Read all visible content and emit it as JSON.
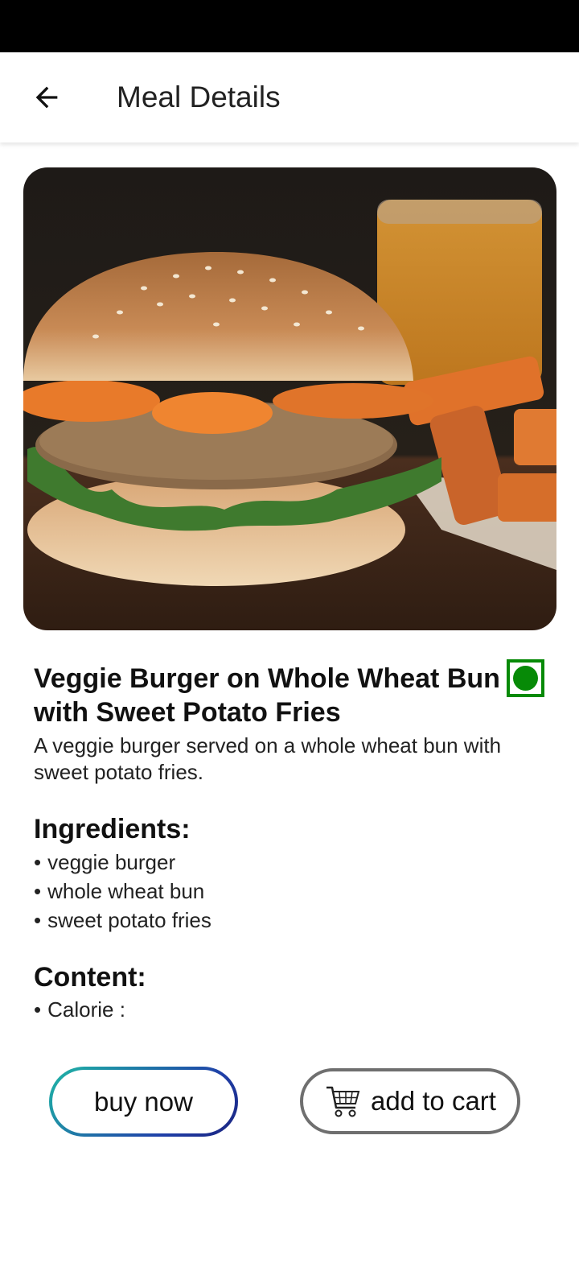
{
  "app_bar": {
    "title": "Meal Details",
    "back_icon": "arrow-left-icon"
  },
  "meal": {
    "name": "Veggie Burger on Whole Wheat Bun with Sweet Potato Fries",
    "description": "A veggie burger served on a whole wheat bun with sweet potato fries.",
    "veg_indicator_color": "#078a07"
  },
  "ingredients": {
    "title": "Ingredients:",
    "items": [
      "veggie burger",
      "whole wheat bun",
      "sweet potato fries"
    ]
  },
  "content": {
    "title": "Content:",
    "items": [
      "Calorie :"
    ]
  },
  "actions": {
    "buy_label": "buy now",
    "cart_label": "add to cart",
    "cart_icon": "shopping-cart-icon"
  },
  "bullet": "•"
}
